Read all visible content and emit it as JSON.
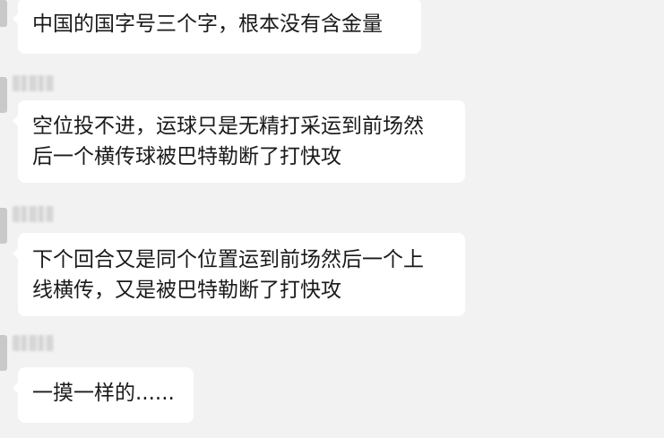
{
  "messages": [
    {
      "lines": [
        "中国的国字号三个字，根本没有含金量"
      ]
    },
    {
      "lines": [
        "空位投不进，运球只是无精打采运到前场然",
        "后一个横传球被巴特勒断了打快攻"
      ]
    },
    {
      "lines": [
        "下个回合又是同个位置运到前场然后一个上",
        "线横传，又是被巴特勒断了打快攻"
      ]
    },
    {
      "lines": [
        "一摸一样的......"
      ]
    }
  ],
  "colors": {
    "background": "#f2f2f2",
    "bubble": "#ffffff",
    "text": "#1a1a1a"
  }
}
